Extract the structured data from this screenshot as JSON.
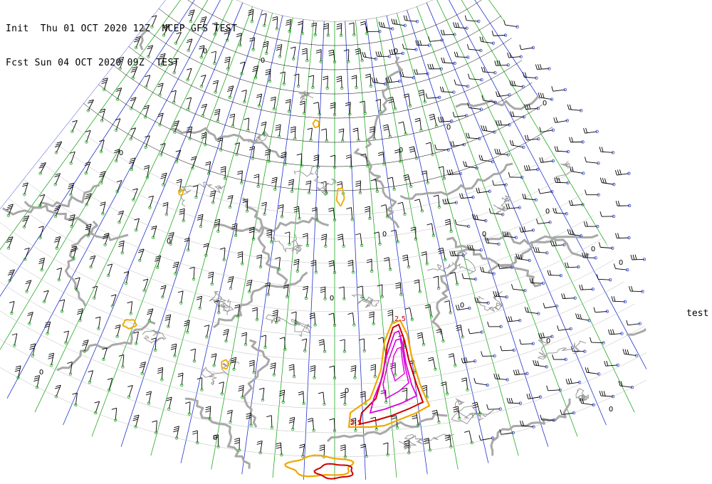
{
  "header": {
    "line1": "Init  Thu 01 OCT 2020 12Z  NCEP GFS TEST",
    "line2": "Fcst Sun 04 OCT 2020 09Z  TEST"
  },
  "side_label": "test",
  "map": {
    "projection": "polar-stereographic",
    "region": "Northern Hemisphere (Europe / Mediterranean / North Africa)",
    "layers": [
      "coastlines",
      "political-borders",
      "wind-barbs-850",
      "gray-contours",
      "precip-contours"
    ],
    "colors": {
      "coastline": "#9a9a9a",
      "thick_contour": "#a8a8a8",
      "latitude_line": "#000000",
      "meridian_blue": "#2233cc",
      "meridian_green": "#22aa22",
      "barb": "#000000",
      "barb_station": "#3344cc",
      "contour_orange": "#f0a800",
      "contour_red": "#cc0000",
      "contour_magenta": "#dd00dd"
    },
    "contour_labels": [
      "0",
      "0",
      "0",
      "0",
      "0",
      "0",
      "0",
      "0",
      "0",
      "0",
      "0",
      "0",
      "0",
      "0",
      "0",
      "0",
      "0",
      "0",
      "0",
      "0",
      "2.5",
      "2.5"
    ]
  }
}
